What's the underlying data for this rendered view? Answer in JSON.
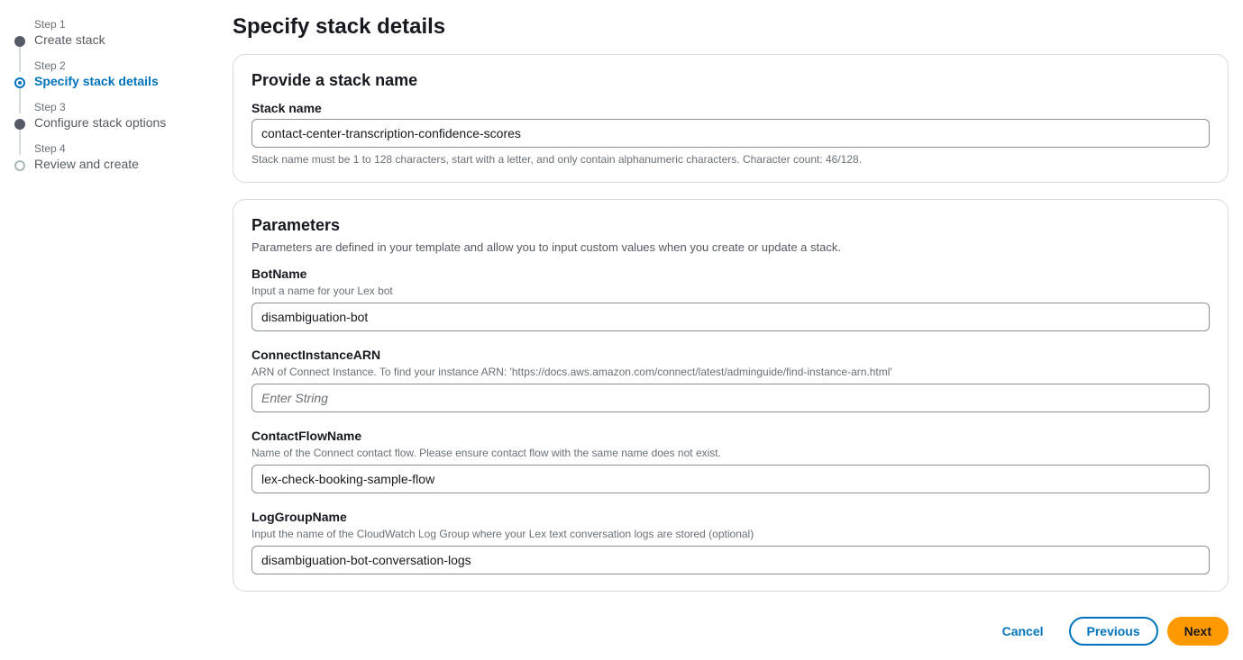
{
  "wizard": {
    "steps": [
      {
        "num": "Step 1",
        "title": "Create stack"
      },
      {
        "num": "Step 2",
        "title": "Specify stack details"
      },
      {
        "num": "Step 3",
        "title": "Configure stack options"
      },
      {
        "num": "Step 4",
        "title": "Review and create"
      }
    ]
  },
  "page": {
    "title": "Specify stack details"
  },
  "stackPanel": {
    "title": "Provide a stack name",
    "fieldLabel": "Stack name",
    "value": "contact-center-transcription-confidence-scores",
    "constraint": "Stack name must be 1 to 128 characters, start with a letter, and only contain alphanumeric characters. Character count: 46/128."
  },
  "parametersPanel": {
    "title": "Parameters",
    "subtext": "Parameters are defined in your template and allow you to input custom values when you create or update a stack.",
    "fields": {
      "botName": {
        "label": "BotName",
        "hint": "Input a name for your Lex bot",
        "value": "disambiguation-bot",
        "placeholder": ""
      },
      "connectInstanceArn": {
        "label": "ConnectInstanceARN",
        "hint": "ARN of Connect Instance. To find your instance ARN: 'https://docs.aws.amazon.com/connect/latest/adminguide/find-instance-arn.html'",
        "value": "",
        "placeholder": "Enter String"
      },
      "contactFlowName": {
        "label": "ContactFlowName",
        "hint": "Name of the Connect contact flow. Please ensure contact flow with the same name does not exist.",
        "value": "lex-check-booking-sample-flow",
        "placeholder": ""
      },
      "logGroupName": {
        "label": "LogGroupName",
        "hint": "Input the name of the CloudWatch Log Group where your Lex text conversation logs are stored (optional)",
        "value": "disambiguation-bot-conversation-logs",
        "placeholder": ""
      }
    }
  },
  "footer": {
    "cancel": "Cancel",
    "previous": "Previous",
    "next": "Next"
  }
}
